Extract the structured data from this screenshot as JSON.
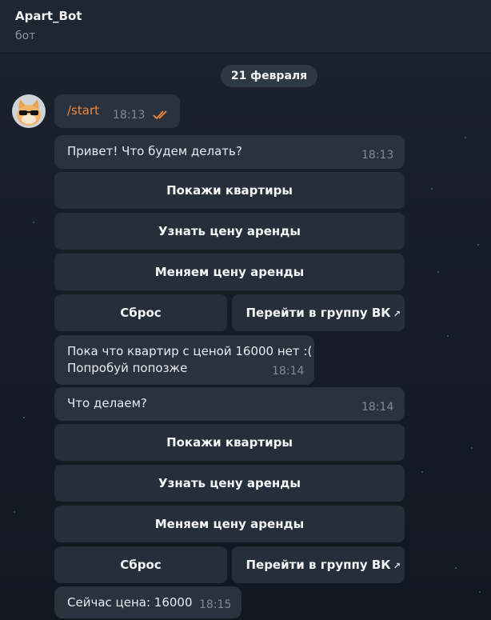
{
  "header": {
    "title": "Apart_Bot",
    "subtitle": "бот"
  },
  "date_separator": "21 февраля",
  "messages": {
    "start": {
      "text": "/start",
      "time": "18:13"
    },
    "greeting": {
      "text": "Привет! Что будем делать?",
      "time": "18:13"
    },
    "no_flats": {
      "line1": "Пока что квартир с ценой 16000 нет :(",
      "line2": "Попробуй попозже",
      "time": "18:14"
    },
    "what_now": {
      "text": "Что делаем?",
      "time": "18:14"
    },
    "current_price": {
      "text": "Сейчас цена: 16000",
      "time": "18:15"
    }
  },
  "keyboard1": {
    "show_flats": "Покажи квартиры",
    "rent_price": "Узнать цену аренды",
    "change_price": "Меняем цену аренды",
    "reset": "Сброс",
    "vk_group": "Перейти в группу ВК"
  },
  "keyboard2": {
    "show_flats": "Покажи квартиры",
    "rent_price": "Узнать цену аренды",
    "change_price": "Меняем цену аренды",
    "reset": "Сброс",
    "vk_group": "Перейти в группу ВК"
  },
  "icons": {
    "read_receipt": "double-check-icon",
    "external_link": "arrow-up-right-icon"
  },
  "colors": {
    "own_message_text": "#f08a3c",
    "read_checks": "#f08a3c",
    "bubble": "#2a323e"
  }
}
